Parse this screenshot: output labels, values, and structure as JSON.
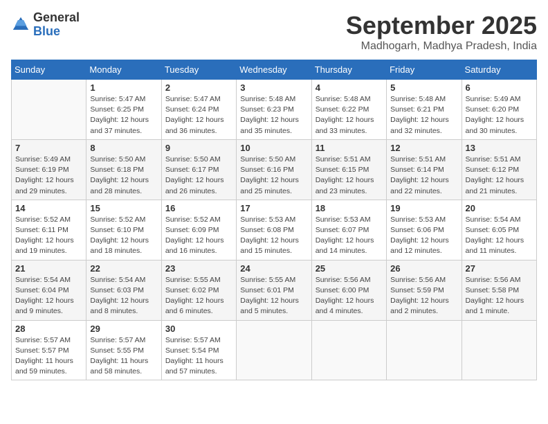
{
  "header": {
    "logo_general": "General",
    "logo_blue": "Blue",
    "month_title": "September 2025",
    "location": "Madhogarh, Madhya Pradesh, India"
  },
  "calendar": {
    "days_of_week": [
      "Sunday",
      "Monday",
      "Tuesday",
      "Wednesday",
      "Thursday",
      "Friday",
      "Saturday"
    ],
    "weeks": [
      [
        {
          "day": "",
          "info": ""
        },
        {
          "day": "1",
          "info": "Sunrise: 5:47 AM\nSunset: 6:25 PM\nDaylight: 12 hours\nand 37 minutes."
        },
        {
          "day": "2",
          "info": "Sunrise: 5:47 AM\nSunset: 6:24 PM\nDaylight: 12 hours\nand 36 minutes."
        },
        {
          "day": "3",
          "info": "Sunrise: 5:48 AM\nSunset: 6:23 PM\nDaylight: 12 hours\nand 35 minutes."
        },
        {
          "day": "4",
          "info": "Sunrise: 5:48 AM\nSunset: 6:22 PM\nDaylight: 12 hours\nand 33 minutes."
        },
        {
          "day": "5",
          "info": "Sunrise: 5:48 AM\nSunset: 6:21 PM\nDaylight: 12 hours\nand 32 minutes."
        },
        {
          "day": "6",
          "info": "Sunrise: 5:49 AM\nSunset: 6:20 PM\nDaylight: 12 hours\nand 30 minutes."
        }
      ],
      [
        {
          "day": "7",
          "info": "Sunrise: 5:49 AM\nSunset: 6:19 PM\nDaylight: 12 hours\nand 29 minutes."
        },
        {
          "day": "8",
          "info": "Sunrise: 5:50 AM\nSunset: 6:18 PM\nDaylight: 12 hours\nand 28 minutes."
        },
        {
          "day": "9",
          "info": "Sunrise: 5:50 AM\nSunset: 6:17 PM\nDaylight: 12 hours\nand 26 minutes."
        },
        {
          "day": "10",
          "info": "Sunrise: 5:50 AM\nSunset: 6:16 PM\nDaylight: 12 hours\nand 25 minutes."
        },
        {
          "day": "11",
          "info": "Sunrise: 5:51 AM\nSunset: 6:15 PM\nDaylight: 12 hours\nand 23 minutes."
        },
        {
          "day": "12",
          "info": "Sunrise: 5:51 AM\nSunset: 6:14 PM\nDaylight: 12 hours\nand 22 minutes."
        },
        {
          "day": "13",
          "info": "Sunrise: 5:51 AM\nSunset: 6:12 PM\nDaylight: 12 hours\nand 21 minutes."
        }
      ],
      [
        {
          "day": "14",
          "info": "Sunrise: 5:52 AM\nSunset: 6:11 PM\nDaylight: 12 hours\nand 19 minutes."
        },
        {
          "day": "15",
          "info": "Sunrise: 5:52 AM\nSunset: 6:10 PM\nDaylight: 12 hours\nand 18 minutes."
        },
        {
          "day": "16",
          "info": "Sunrise: 5:52 AM\nSunset: 6:09 PM\nDaylight: 12 hours\nand 16 minutes."
        },
        {
          "day": "17",
          "info": "Sunrise: 5:53 AM\nSunset: 6:08 PM\nDaylight: 12 hours\nand 15 minutes."
        },
        {
          "day": "18",
          "info": "Sunrise: 5:53 AM\nSunset: 6:07 PM\nDaylight: 12 hours\nand 14 minutes."
        },
        {
          "day": "19",
          "info": "Sunrise: 5:53 AM\nSunset: 6:06 PM\nDaylight: 12 hours\nand 12 minutes."
        },
        {
          "day": "20",
          "info": "Sunrise: 5:54 AM\nSunset: 6:05 PM\nDaylight: 12 hours\nand 11 minutes."
        }
      ],
      [
        {
          "day": "21",
          "info": "Sunrise: 5:54 AM\nSunset: 6:04 PM\nDaylight: 12 hours\nand 9 minutes."
        },
        {
          "day": "22",
          "info": "Sunrise: 5:54 AM\nSunset: 6:03 PM\nDaylight: 12 hours\nand 8 minutes."
        },
        {
          "day": "23",
          "info": "Sunrise: 5:55 AM\nSunset: 6:02 PM\nDaylight: 12 hours\nand 6 minutes."
        },
        {
          "day": "24",
          "info": "Sunrise: 5:55 AM\nSunset: 6:01 PM\nDaylight: 12 hours\nand 5 minutes."
        },
        {
          "day": "25",
          "info": "Sunrise: 5:56 AM\nSunset: 6:00 PM\nDaylight: 12 hours\nand 4 minutes."
        },
        {
          "day": "26",
          "info": "Sunrise: 5:56 AM\nSunset: 5:59 PM\nDaylight: 12 hours\nand 2 minutes."
        },
        {
          "day": "27",
          "info": "Sunrise: 5:56 AM\nSunset: 5:58 PM\nDaylight: 12 hours\nand 1 minute."
        }
      ],
      [
        {
          "day": "28",
          "info": "Sunrise: 5:57 AM\nSunset: 5:57 PM\nDaylight: 11 hours\nand 59 minutes."
        },
        {
          "day": "29",
          "info": "Sunrise: 5:57 AM\nSunset: 5:55 PM\nDaylight: 11 hours\nand 58 minutes."
        },
        {
          "day": "30",
          "info": "Sunrise: 5:57 AM\nSunset: 5:54 PM\nDaylight: 11 hours\nand 57 minutes."
        },
        {
          "day": "",
          "info": ""
        },
        {
          "day": "",
          "info": ""
        },
        {
          "day": "",
          "info": ""
        },
        {
          "day": "",
          "info": ""
        }
      ]
    ]
  }
}
